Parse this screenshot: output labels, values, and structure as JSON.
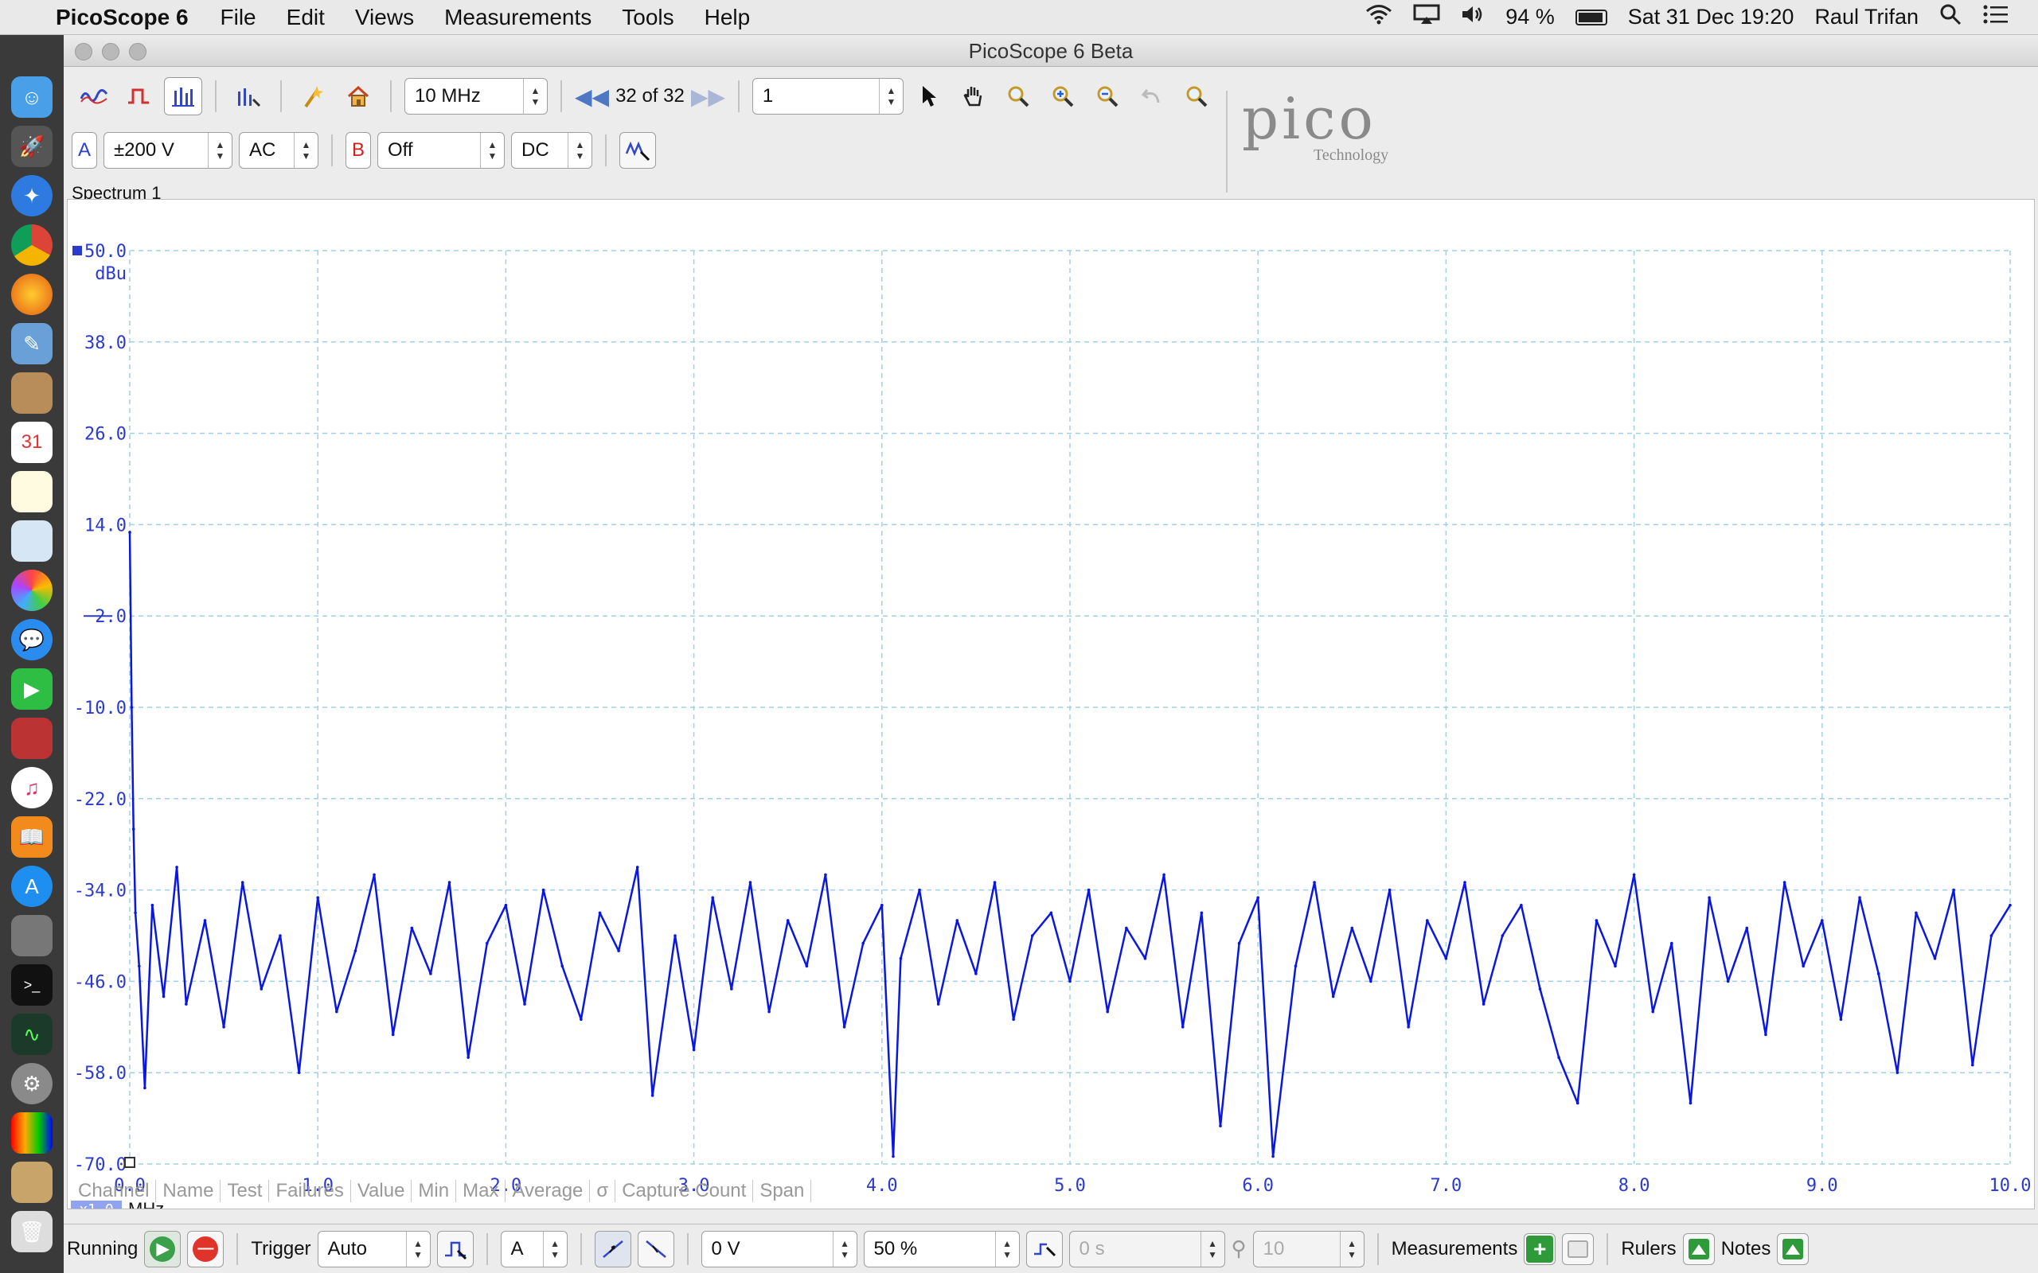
{
  "menubar": {
    "app_name": "PicoScope 6",
    "items": [
      "File",
      "Edit",
      "Views",
      "Measurements",
      "Tools",
      "Help"
    ],
    "battery": "94 %",
    "datetime": "Sat 31 Dec  19:20",
    "user": "Raul Trifan"
  },
  "window": {
    "title": "PicoScope 6 Beta"
  },
  "toolbar": {
    "timebase": "10 MHz",
    "buffer_position": "32 of 32",
    "capture_count": "1"
  },
  "channel_a": {
    "letter": "A",
    "range": "±200 V",
    "coupling": "AC"
  },
  "channel_b": {
    "letter": "B",
    "range": "Off",
    "coupling": "DC"
  },
  "logo": {
    "main": "pico",
    "sub": "Technology"
  },
  "view": {
    "title": "Spectrum 1",
    "y_unit": "dBu",
    "x_unit": "MHz",
    "zoom": "x1.0"
  },
  "chart_data": {
    "type": "line",
    "title": "Spectrum 1",
    "xlabel": "MHz",
    "ylabel": "dBu",
    "xlim": [
      0.0,
      10.0
    ],
    "ylim": [
      -70.0,
      50.0
    ],
    "x_ticks": [
      "0.0",
      "1.0",
      "2.0",
      "3.0",
      "4.0",
      "5.0",
      "6.0",
      "7.0",
      "8.0",
      "9.0",
      "10.0"
    ],
    "y_ticks": [
      "50.0",
      "38.0",
      "26.0",
      "14.0",
      "2.0",
      "-10.0",
      "-22.0",
      "-34.0",
      "-46.0",
      "-58.0",
      "-70.0"
    ],
    "grid": true,
    "series": [
      {
        "color": "#0a17e0",
        "x": [
          0.0,
          0.01,
          0.02,
          0.03,
          0.05,
          0.08,
          0.12,
          0.18,
          0.25,
          0.3,
          0.4,
          0.5,
          0.6,
          0.7,
          0.8,
          0.9,
          1.0,
          1.1,
          1.2,
          1.3,
          1.4,
          1.5,
          1.6,
          1.7,
          1.8,
          1.9,
          2.0,
          2.1,
          2.2,
          2.3,
          2.4,
          2.5,
          2.6,
          2.7,
          2.78,
          2.9,
          3.0,
          3.1,
          3.2,
          3.3,
          3.4,
          3.5,
          3.6,
          3.7,
          3.8,
          3.9,
          4.0,
          4.06,
          4.1,
          4.2,
          4.3,
          4.4,
          4.5,
          4.6,
          4.7,
          4.8,
          4.9,
          5.0,
          5.1,
          5.2,
          5.3,
          5.4,
          5.5,
          5.6,
          5.7,
          5.8,
          5.9,
          6.0,
          6.08,
          6.2,
          6.3,
          6.4,
          6.5,
          6.6,
          6.7,
          6.8,
          6.9,
          7.0,
          7.1,
          7.2,
          7.3,
          7.4,
          7.5,
          7.6,
          7.7,
          7.8,
          7.9,
          8.0,
          8.1,
          8.2,
          8.3,
          8.4,
          8.5,
          8.6,
          8.7,
          8.8,
          8.9,
          9.0,
          9.1,
          9.2,
          9.3,
          9.4,
          9.5,
          9.6,
          9.7,
          9.8,
          9.9,
          10.0
        ],
        "y": [
          13.0,
          -10.0,
          -26.0,
          -37.0,
          -44.0,
          -60.0,
          -36.0,
          -48.0,
          -31.0,
          -49.0,
          -38.0,
          -52.0,
          -33.0,
          -47.0,
          -40.0,
          -58.0,
          -35.0,
          -50.0,
          -42.0,
          -32.0,
          -53.0,
          -39.0,
          -45.0,
          -33.0,
          -56.0,
          -41.0,
          -36.0,
          -49.0,
          -34.0,
          -44.0,
          -51.0,
          -37.0,
          -42.0,
          -31.0,
          -61.0,
          -40.0,
          -55.0,
          -35.0,
          -47.0,
          -33.0,
          -50.0,
          -38.0,
          -44.0,
          -32.0,
          -52.0,
          -41.0,
          -36.0,
          -69.0,
          -43.0,
          -34.0,
          -49.0,
          -38.0,
          -45.0,
          -33.0,
          -51.0,
          -40.0,
          -37.0,
          -46.0,
          -34.0,
          -50.0,
          -39.0,
          -43.0,
          -32.0,
          -52.0,
          -37.0,
          -65.0,
          -41.0,
          -35.0,
          -69.0,
          -44.0,
          -33.0,
          -48.0,
          -39.0,
          -46.0,
          -34.0,
          -52.0,
          -38.0,
          -43.0,
          -33.0,
          -49.0,
          -40.0,
          -36.0,
          -47.0,
          -56.0,
          -62.0,
          -38.0,
          -44.0,
          -32.0,
          -50.0,
          -41.0,
          -62.0,
          -35.0,
          -46.0,
          -39.0,
          -53.0,
          -33.0,
          -44.0,
          -38.0,
          -51.0,
          -35.0,
          -45.0,
          -58.0,
          -37.0,
          -43.0,
          -34.0,
          -57.0,
          -40.0,
          -36.0
        ]
      }
    ]
  },
  "measurements_header": [
    "Channel",
    "Name",
    "Test",
    "Failures",
    "Value",
    "Min",
    "Max",
    "Average",
    "σ",
    "Capture Count",
    "Span"
  ],
  "bottombar": {
    "running_label": "Running",
    "trigger_label": "Trigger",
    "trigger_mode": "Auto",
    "trigger_channel": "A",
    "trigger_level": "0 V",
    "pre_trigger": "50 %",
    "delay": "0 s",
    "hysteresis": "10",
    "measurements_label": "Measurements",
    "rulers_label": "Rulers",
    "notes_label": "Notes"
  }
}
